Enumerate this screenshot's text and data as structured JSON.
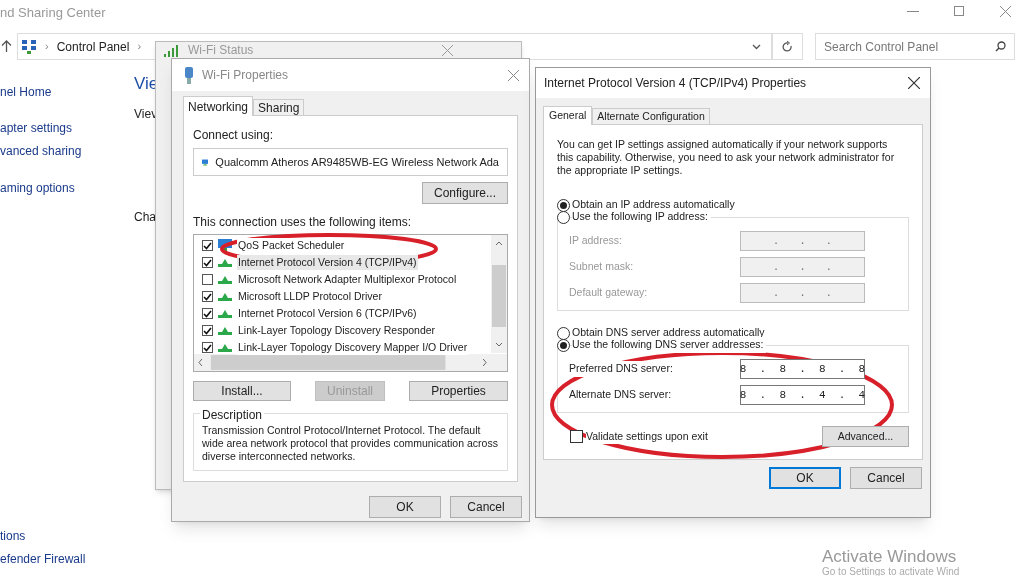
{
  "explorer": {
    "title": "nd Sharing Center",
    "breadcrumb": [
      {
        "kind": "separator",
        "text": "›"
      },
      {
        "kind": "item",
        "text": "Control Panel"
      },
      {
        "kind": "separator",
        "text": "›"
      }
    ],
    "search": {
      "placeholder": "Search Control Panel"
    },
    "sidebar": {
      "items": [
        "nel Home",
        "apter settings",
        "vanced sharing",
        "aming options",
        "tions",
        "efender Firewall"
      ]
    },
    "main": {
      "heading": "Vie",
      "line_1": "Viev",
      "line_2": "Cha"
    }
  },
  "wifi_status": {
    "title": "Wi-Fi Status"
  },
  "wifi_properties": {
    "title": "Wi-Fi Properties",
    "tabs": [
      {
        "label": "Networking",
        "selected": true
      },
      {
        "label": "Sharing",
        "selected": false
      }
    ],
    "connect_using_label": "Connect using:",
    "adapter": "Qualcomm Atheros AR9485WB-EG Wireless Network Ada",
    "configure_button": "Configure...",
    "items_label": "This connection uses the following items:",
    "items": [
      {
        "label": "QoS Packet Scheduler",
        "kind": "service",
        "checked": true,
        "selected": false
      },
      {
        "label": "Internet Protocol Version 4 (TCP/IPv4)",
        "kind": "protocol",
        "checked": true,
        "selected": true
      },
      {
        "label": "Microsoft Network Adapter Multiplexor Protocol",
        "kind": "protocol",
        "checked": false,
        "selected": false
      },
      {
        "label": "Microsoft LLDP Protocol Driver",
        "kind": "protocol",
        "checked": true,
        "selected": false
      },
      {
        "label": "Internet Protocol Version 6 (TCP/IPv6)",
        "kind": "protocol",
        "checked": true,
        "selected": false
      },
      {
        "label": "Link-Layer Topology Discovery Responder",
        "kind": "protocol",
        "checked": true,
        "selected": false
      },
      {
        "label": "Link-Layer Topology Discovery Mapper I/O Driver",
        "kind": "protocol",
        "checked": true,
        "selected": false
      }
    ],
    "buttons": [
      {
        "label": "Install...",
        "disabled": false
      },
      {
        "label": "Uninstall",
        "disabled": true
      },
      {
        "label": "Properties",
        "disabled": false
      }
    ],
    "description_title": "Description",
    "description_text": "Transmission Control Protocol/Internet Protocol. The default wide area network protocol that provides communication across diverse interconnected networks.",
    "footer_buttons": [
      "OK",
      "Cancel"
    ]
  },
  "ipv4_properties": {
    "title": "Internet Protocol Version 4 (TCP/IPv4) Properties",
    "tabs": [
      {
        "label": "General",
        "selected": true
      },
      {
        "label": "Alternate Configuration",
        "selected": false
      }
    ],
    "intro": "You can get IP settings assigned automatically if your network supports this capability. Otherwise, you need to ask your network administrator for the appropriate IP settings.",
    "ip_options": [
      {
        "label": "Obtain an IP address automatically",
        "selected": true
      },
      {
        "label": "Use the following IP address:",
        "selected": false
      }
    ],
    "ip_fields": [
      {
        "label": "IP address:",
        "value": ".   .   .",
        "disabled": true
      },
      {
        "label": "Subnet mask:",
        "value": ".   .   .",
        "disabled": true
      },
      {
        "label": "Default gateway:",
        "value": ".   .   .",
        "disabled": true
      }
    ],
    "dns_options": [
      {
        "label": "Obtain DNS server address automatically",
        "selected": false
      },
      {
        "label": "Use the following DNS server addresses:",
        "selected": true
      }
    ],
    "dns_fields": [
      {
        "label": "Preferred DNS server:",
        "value": "8  .  8  .  8  .  8",
        "disabled": false
      },
      {
        "label": "Alternate DNS server:",
        "value": "8  .  8  .  4  .  4",
        "disabled": false
      }
    ],
    "validate": {
      "label": "Validate settings upon exit",
      "checked": false
    },
    "advanced_button": "Advanced...",
    "footer_buttons": [
      "OK",
      "Cancel"
    ]
  },
  "activation": {
    "title": "Activate Windows",
    "subtitle": "Go to Settings to activate Wind"
  }
}
